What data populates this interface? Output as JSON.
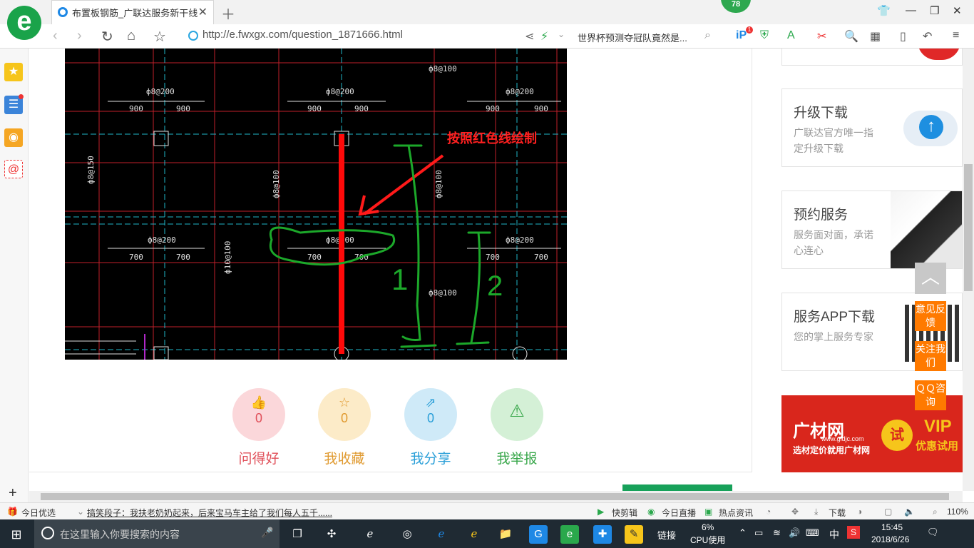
{
  "browser": {
    "tab_title": "布置板钢筋_广联达服务新干线",
    "badge": "78",
    "url": "http://e.fwxgx.com/question_1871666.html",
    "search_text": "世界杯预测夺冠队竟然是...",
    "toolbar_badge": "1"
  },
  "cad": {
    "annotation": "按照红色线绘制",
    "labels": [
      {
        "t": "ф8@100"
      },
      {
        "t": "ф8@200"
      },
      {
        "t": "900"
      },
      {
        "t": "900"
      },
      {
        "t": "ф8@200"
      },
      {
        "t": "900"
      },
      {
        "t": "900"
      },
      {
        "t": "ф8@200"
      },
      {
        "t": "900"
      },
      {
        "t": "900"
      },
      {
        "t": "ф8@150"
      },
      {
        "t": "ф8@100"
      },
      {
        "t": "ф8@100"
      },
      {
        "t": "ф8@200"
      },
      {
        "t": "700"
      },
      {
        "t": "700"
      },
      {
        "t": "ф8@200"
      },
      {
        "t": "700"
      },
      {
        "t": "700"
      },
      {
        "t": "ф8@200"
      },
      {
        "t": "700"
      },
      {
        "t": "700"
      },
      {
        "t": "ф10@100"
      },
      {
        "t": "ф8@100"
      }
    ],
    "mark1": "1",
    "mark2": "2"
  },
  "stats": [
    {
      "value": "0",
      "label": "问得好",
      "color": "#e0505a",
      "bg": "#fbd7da",
      "icon": "thumb-up-icon"
    },
    {
      "value": "0",
      "label": "我收藏",
      "color": "#e09a30",
      "bg": "#fcebc8",
      "icon": "star-icon"
    },
    {
      "value": "0",
      "label": "我分享",
      "color": "#2a9fd8",
      "bg": "#cfeaf8",
      "icon": "share-icon"
    },
    {
      "value": "",
      "label": "我举报",
      "color": "#3aa84c",
      "bg": "#d4f0d6",
      "icon": "warning-icon"
    }
  ],
  "cards": [
    {
      "title": "升级下载",
      "desc": "广联达官方唯一指定升级下载"
    },
    {
      "title": "预约服务",
      "desc": "服务面对面，承诺心连心"
    },
    {
      "title": "服务APP下载",
      "desc": "您的掌上服务专家"
    }
  ],
  "ad": {
    "brand": "广材网",
    "site": "www.gldjc.com",
    "slogan": "选材定价就用广材网",
    "badge": "试",
    "vip": "VIP",
    "vip_sub": "优惠试用"
  },
  "float_buttons": {
    "feedback": "意见反馈",
    "follow": "关注我们",
    "qq": "ＱＱ咨询"
  },
  "statusbar": {
    "today": "今日优选",
    "news": "搞笑段子：我扶老奶奶起来，后来宝马车主给了我们每人五千......",
    "kuaijianji": "快剪辑",
    "live": "今日直播",
    "hot": "热点资讯",
    "download": "下载",
    "zoom": "110%"
  },
  "taskbar": {
    "search_placeholder": "在这里输入你要搜索的内容",
    "link": "链接",
    "cpu": "6%",
    "cpu_label": "CPU使用",
    "ime": "中",
    "time": "15:45",
    "date": "2018/6/26"
  }
}
